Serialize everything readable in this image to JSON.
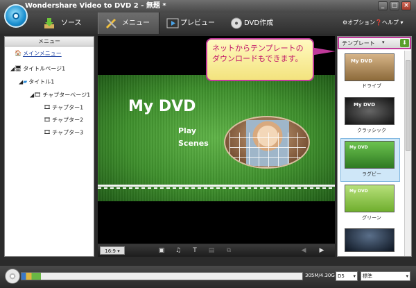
{
  "window": {
    "title": "Wondershare Video to DVD 2 - 無題 *",
    "min": "_",
    "max": "□",
    "close": "×"
  },
  "tabs": [
    {
      "label": "ソース"
    },
    {
      "label": "メニュー"
    },
    {
      "label": "プレビュー"
    },
    {
      "label": "DVD作成"
    }
  ],
  "header_links": {
    "options": "オプション",
    "help": "ヘルプ"
  },
  "menu_tree": {
    "title": "メニュー",
    "items": [
      "メインメニュー",
      "タイトルページ1",
      "タイトル1",
      "チャプターページ1",
      "チャプター1",
      "チャプター2",
      "チャプター3"
    ]
  },
  "preview": {
    "dvd_title": "My DVD",
    "play": "Play",
    "scenes": "Scenes",
    "aspect": "16:9"
  },
  "callout": "ネットからテンプレートのダウンロードもできます。",
  "templates": {
    "header": "テンプレート",
    "items": [
      {
        "name": "ドライブ",
        "thumb_text": "My DVD"
      },
      {
        "name": "クラッシック",
        "thumb_text": "My DVD"
      },
      {
        "name": "ラグビー",
        "thumb_text": "My DVD"
      },
      {
        "name": "グリーン",
        "thumb_text": "My DVD"
      },
      {
        "name": "",
        "thumb_text": ""
      }
    ]
  },
  "status": {
    "capacity": "305M/4.30G",
    "capacity_fraction": 0.07,
    "disc_type": "D5",
    "quality": "標準"
  }
}
